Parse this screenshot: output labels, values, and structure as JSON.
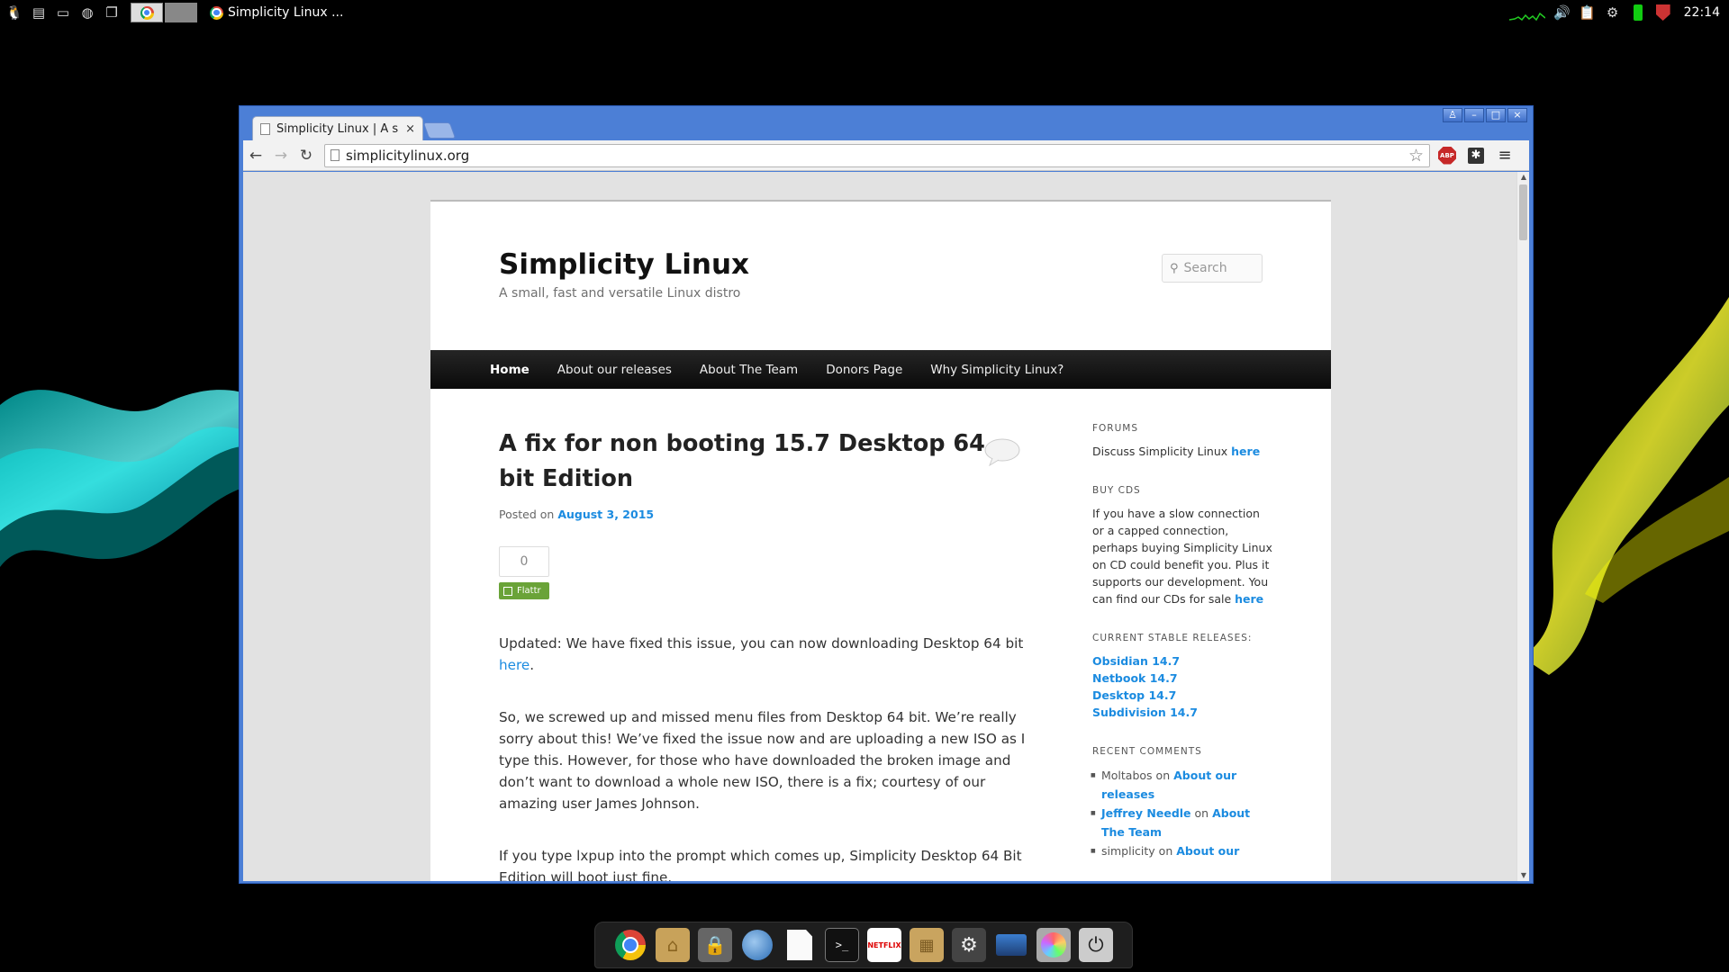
{
  "top_panel": {
    "task_title": "Simplicity Linux ...",
    "clock": "22:14"
  },
  "browser": {
    "tab_title": "Simplicity Linux | A s",
    "tab_close": "×",
    "url": "simplicitylinux.org",
    "window_controls": [
      "♙",
      "–",
      "□",
      "×"
    ],
    "abp_label": "ABP"
  },
  "site": {
    "title": "Simplicity Linux",
    "description": "A small, fast and versatile Linux distro",
    "search_placeholder": "Search",
    "nav": [
      "Home",
      "About our releases",
      "About The Team",
      "Donors Page",
      "Why Simplicity Linux?"
    ],
    "active_nav": "Home"
  },
  "post": {
    "title": "A fix for non booting 15.7 Desktop 64 bit Edition",
    "posted_prefix": "Posted on",
    "posted_date": "August 3, 2015",
    "flattr_count": "0",
    "flattr_label": "Flattr",
    "p1_text": "Updated: We have fixed this issue, you can now downloading Desktop 64 bit",
    "p1_link": "here",
    "p1_end": ".",
    "p2": "So, we screwed up and missed menu files from Desktop 64 bit.  We’re really sorry about this!  We’ve fixed the issue now and are uploading a new ISO as I type this.  However, for those who have downloaded the broken image and don’t want to download a whole new ISO, there is a fix; courtesy of our amazing user James Johnson.",
    "p3": "If you type lxpup into the prompt which comes up, Simplicity Desktop 64 Bit Edition will boot just fine."
  },
  "sidebar": {
    "forums_head": "Forums",
    "forums_text": "Discuss Simplicity Linux",
    "forums_link": "here",
    "buy_head": "Buy CDs",
    "buy_text": "If you have a slow connection or a capped connection, perhaps buying Simplicity Linux on CD could benefit you. Plus it supports our development. You can find our CDs for sale",
    "buy_link": "here",
    "releases_head": "Current Stable Releases:",
    "releases": [
      "Obsidian 14.7",
      "Netbook 14.7",
      "Desktop 14.7",
      "Subdivision 14.7"
    ],
    "comments_head": "Recent Comments",
    "comments": [
      {
        "author": "Moltabos",
        "on": "on",
        "post": "About our releases"
      },
      {
        "author": "Jeffrey Needle",
        "on": "on",
        "post": "About The Team"
      },
      {
        "author": "simplicity",
        "on": "on",
        "post": "About our"
      }
    ]
  },
  "dock": {
    "items": [
      "chrome-icon",
      "home-folder-icon",
      "lock-icon",
      "thunderbird-icon",
      "text-file-icon",
      "terminal-icon",
      "netflix-icon",
      "package-icon",
      "settings-icon",
      "network-icon",
      "disc-burner-icon",
      "power-icon"
    ],
    "netflix_label": "NETFLIX"
  }
}
